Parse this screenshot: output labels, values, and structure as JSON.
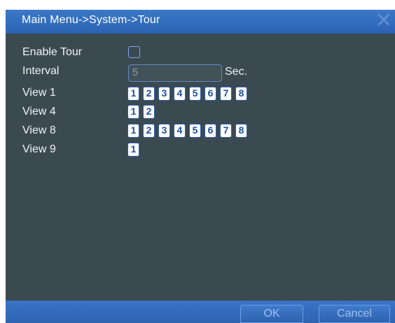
{
  "title": "Main Menu->System->Tour",
  "close_icon": "close-icon",
  "enable_tour": {
    "label": "Enable Tour",
    "checked": false
  },
  "interval": {
    "label": "Interval",
    "value": "5",
    "unit": "Sec."
  },
  "views": [
    {
      "label": "View 1",
      "channels": [
        "1",
        "2",
        "3",
        "4",
        "5",
        "6",
        "7",
        "8"
      ]
    },
    {
      "label": "View 4",
      "channels": [
        "1",
        "2"
      ]
    },
    {
      "label": "View 8",
      "channels": [
        "1",
        "2",
        "3",
        "4",
        "5",
        "6",
        "7",
        "8"
      ]
    },
    {
      "label": "View 9",
      "channels": [
        "1"
      ]
    }
  ],
  "buttons": {
    "ok": "OK",
    "cancel": "Cancel"
  },
  "colors": {
    "background": "#3b4a50",
    "titlebar": "#2c63b3",
    "accent": "#7aa7ee"
  }
}
